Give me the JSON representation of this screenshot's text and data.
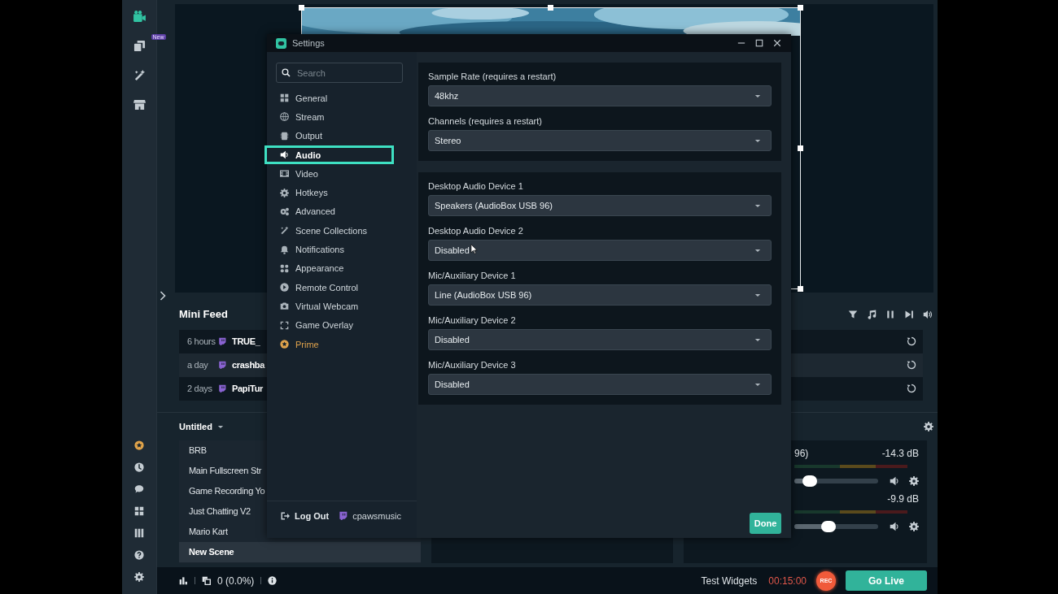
{
  "rail": {
    "top_items": [
      {
        "kind": "camera",
        "selected": true
      },
      {
        "kind": "layers",
        "selected": false,
        "badge": "New"
      },
      {
        "kind": "wand",
        "selected": false
      },
      {
        "kind": "store",
        "selected": false
      }
    ],
    "bottom_items": [
      {
        "kind": "prime"
      },
      {
        "kind": "clock"
      },
      {
        "kind": "chat"
      },
      {
        "kind": "grid"
      },
      {
        "kind": "columns"
      },
      {
        "kind": "help"
      },
      {
        "kind": "gear"
      }
    ]
  },
  "mini_feed": {
    "title": "Mini Feed",
    "events": [
      {
        "time": "6 hours",
        "name": "TRUE_"
      },
      {
        "time": "a day",
        "name": "crashba"
      },
      {
        "time": "2 days",
        "name": "PapiTur"
      }
    ]
  },
  "scenes": {
    "collection": "Untitled",
    "items": [
      {
        "name": "BRB",
        "selected": false
      },
      {
        "name": "Main Fullscreen Str",
        "selected": false
      },
      {
        "name": "Game Recording Yo",
        "selected": false
      },
      {
        "name": "Just Chatting V2",
        "selected": false
      },
      {
        "name": "Mario Kart",
        "selected": false
      },
      {
        "name": "New Scene",
        "selected": true
      }
    ]
  },
  "mixer": {
    "channels": [
      {
        "name": "96)",
        "reading": "-14.3 dB",
        "level": 0.18
      },
      {
        "reading": "-9.9 dB",
        "level": 0.41
      }
    ]
  },
  "footer": {
    "performance": "0 (0.0%)",
    "test_widgets": "Test Widgets",
    "timer": "00:15:00",
    "rec": "REC",
    "go_live": "Go Live"
  },
  "settings": {
    "title": "Settings",
    "search": {
      "placeholder": "Search"
    },
    "nav": [
      {
        "label": "General",
        "kind": "grid",
        "selected": false
      },
      {
        "label": "Stream",
        "kind": "globe",
        "selected": false
      },
      {
        "label": "Output",
        "kind": "chip",
        "selected": false
      },
      {
        "label": "Audio",
        "kind": "speaker",
        "selected": true
      },
      {
        "label": "Video",
        "kind": "film",
        "selected": false
      },
      {
        "label": "Hotkeys",
        "kind": "gear",
        "selected": false
      },
      {
        "label": "Advanced",
        "kind": "gears",
        "selected": false
      },
      {
        "label": "Scene Collections",
        "kind": "wand",
        "selected": false
      },
      {
        "label": "Notifications",
        "kind": "bell",
        "selected": false
      },
      {
        "label": "Appearance",
        "kind": "tiles",
        "selected": false
      },
      {
        "label": "Remote Control",
        "kind": "play",
        "selected": false
      },
      {
        "label": "Virtual Webcam",
        "selected": false
      },
      {
        "label": "Game Overlay",
        "kind": "expand",
        "selected": false
      },
      {
        "label": "Prime",
        "kind": "prime",
        "selected": false
      }
    ],
    "logout": "Log Out",
    "user": "cpawsmusic",
    "sections": [
      {
        "fields": [
          {
            "label": "Sample Rate (requires a restart)",
            "value": "48khz"
          },
          {
            "label": "Channels (requires a restart)",
            "value": "Stereo"
          }
        ]
      },
      {
        "fields": [
          {
            "label": "Desktop Audio Device 1",
            "value": "Speakers (AudioBox USB 96)"
          },
          {
            "label": "Desktop Audio Device 2",
            "value": "Disabled"
          },
          {
            "label": "Mic/Auxiliary Device 1",
            "value": "Line (AudioBox USB 96)"
          },
          {
            "label": "Mic/Auxiliary Device 2",
            "value": "Disabled"
          },
          {
            "label": "Mic/Auxiliary Device 3",
            "value": "Disabled"
          }
        ]
      }
    ],
    "done": "Done"
  }
}
